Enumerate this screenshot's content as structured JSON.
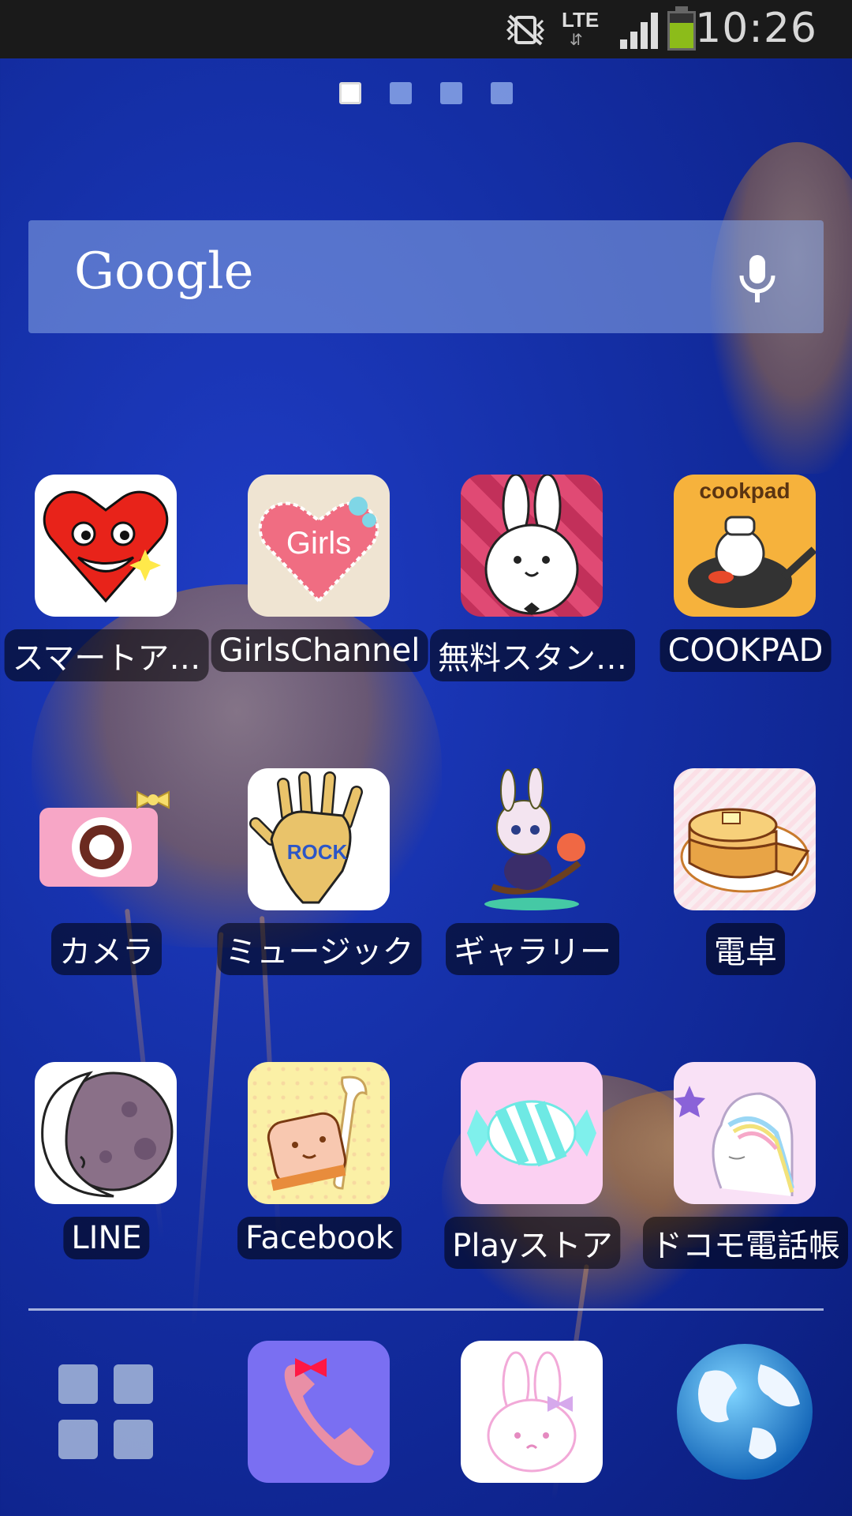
{
  "status": {
    "time": "10:26",
    "network": "LTE",
    "network_arrows": "⇵",
    "mute_icon": "vibrate-off-icon",
    "signal_bars": 4,
    "battery_level": 0.72
  },
  "pager": {
    "pages": 4,
    "active_index": 0
  },
  "search": {
    "logo": "Google",
    "mic_icon": "microphone-icon"
  },
  "apps": [
    {
      "label": "スマートア…",
      "icon": "heart-face-icon"
    },
    {
      "label": "GirlsChannel",
      "icon": "girls-heart-icon",
      "icon_text": "Girls"
    },
    {
      "label": "無料スタン…",
      "icon": "rabbit-icon"
    },
    {
      "label": "COOKPAD",
      "icon": "cookpad-icon",
      "icon_text": "cookpad"
    },
    {
      "label": "カメラ",
      "icon": "camera-icon"
    },
    {
      "label": "ミュージック",
      "icon": "rock-hand-icon",
      "icon_text": "ROCK"
    },
    {
      "label": "ギャラリー",
      "icon": "bunny-character-icon"
    },
    {
      "label": "電卓",
      "icon": "pancake-icon"
    },
    {
      "label": "LINE",
      "icon": "moon-icon"
    },
    {
      "label": "Facebook",
      "icon": "bread-icon"
    },
    {
      "label": "Playストア",
      "icon": "candy-icon"
    },
    {
      "label": "ドコモ電話帳",
      "icon": "unicorn-icon"
    }
  ],
  "dock": [
    {
      "name": "app-drawer",
      "icon": "grid-icon"
    },
    {
      "name": "phone",
      "icon": "phone-receiver-icon"
    },
    {
      "name": "messages",
      "icon": "bunny-face-icon"
    },
    {
      "name": "browser",
      "icon": "globe-icon"
    }
  ]
}
